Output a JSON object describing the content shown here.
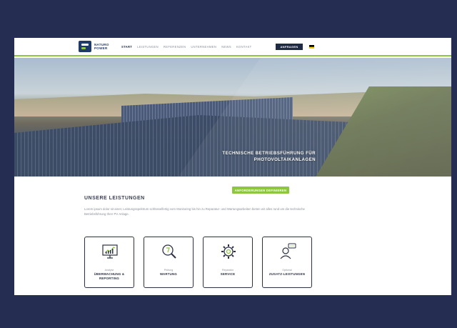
{
  "header": {
    "logo": {
      "line1": "NATURO",
      "line2": "POWER"
    },
    "nav": [
      "START",
      "LEISTUNGEN",
      "REFERENZEN",
      "UNTERNEHMEN",
      "NEWS",
      "KONTAKT"
    ],
    "cta_label": "ANFRAGEN",
    "flag_colors": [
      "#000000",
      "#dd0000",
      "#ffce00"
    ]
  },
  "hero": {
    "title_line1": "TECHNISCHE BETRIEBSFÜHRUNG FÜR",
    "title_line2": "PHOTOVOLTAIKANLAGEN",
    "cta_label": "ANFORDERUNGEN DEFINIEREN",
    "slide_count": 5,
    "active_slide": 1
  },
  "services": {
    "title": "UNSERE LEISTUNGEN",
    "text": "Lorem ipsum dolor sit amet, Leistungsspektrum schlüsselfertig vom Monitoring bis hin zu Reparatur- und Wartungsarbeiten bieten wir alles rund um die technische Betriebsführung Ihrer PV Anlage.",
    "cards": [
      {
        "kicker": "Analyse",
        "label": "ÜBERWACHUNG & REPORTING",
        "icon": "chart-monitor-icon"
      },
      {
        "kicker": "Prüfung",
        "label": "WARTUNG",
        "icon": "magnifier-icon"
      },
      {
        "kicker": "Reparatur",
        "label": "SERVICE",
        "icon": "gear-icon"
      },
      {
        "kicker": "Optional",
        "label": "ZUSATZ-LEISTUNGEN",
        "icon": "support-person-icon"
      }
    ]
  },
  "colors": {
    "accent": "#8dc63f",
    "dark": "#1f2a44",
    "frame": "#262d52"
  }
}
